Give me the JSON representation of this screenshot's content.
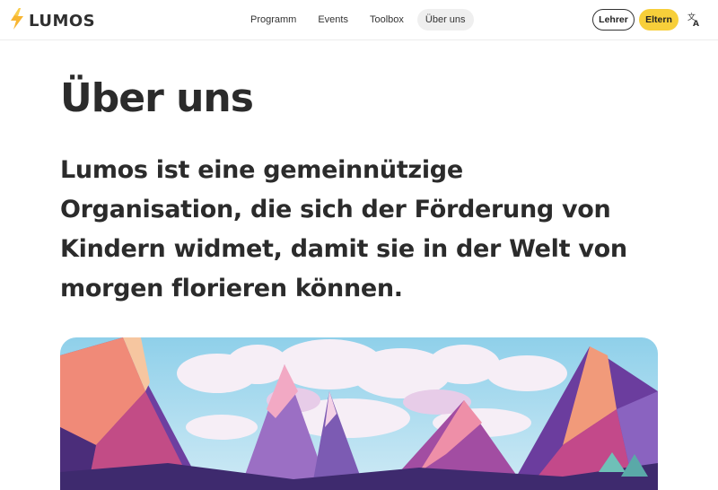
{
  "header": {
    "logo_text": "LUMOS",
    "nav": [
      "Programm",
      "Events",
      "Toolbox",
      "Über uns"
    ],
    "active_nav": "Über uns",
    "lehrer_label": "Lehrer",
    "eltern_label": "Eltern"
  },
  "main": {
    "title": "Über uns",
    "intro": "Lumos ist eine gemeinnützige Organisation, die sich der Förderung von Kindern widmet, damit sie in der Welt von morgen florieren können."
  },
  "colors": {
    "accent": "#f7cf3a",
    "text": "#2b2b2b"
  },
  "icons": [
    "lightning-bolt-icon",
    "translate-icon"
  ]
}
